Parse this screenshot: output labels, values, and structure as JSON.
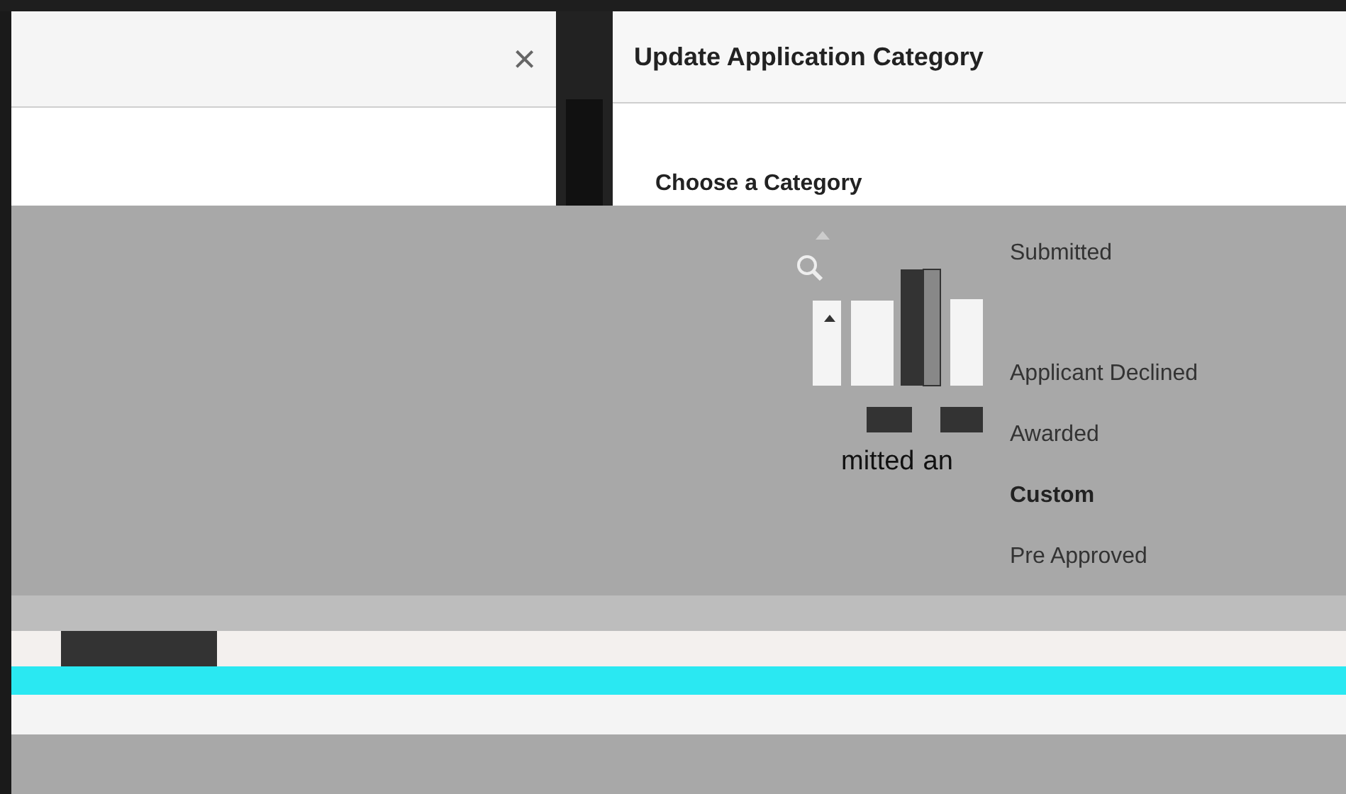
{
  "left_panel": {
    "close_label": "×"
  },
  "dialog": {
    "title": "Update Application Category",
    "prompt": "Choose a Category"
  },
  "categories": [
    {
      "label": "Submitted",
      "selected": false
    },
    {
      "label": "Applicant Declined",
      "selected": false
    },
    {
      "label": "Awarded",
      "selected": false
    },
    {
      "label": "Custom",
      "selected": true
    },
    {
      "label": "Pre Approved",
      "selected": false
    }
  ],
  "fragments": [
    "mitted",
    "an"
  ]
}
